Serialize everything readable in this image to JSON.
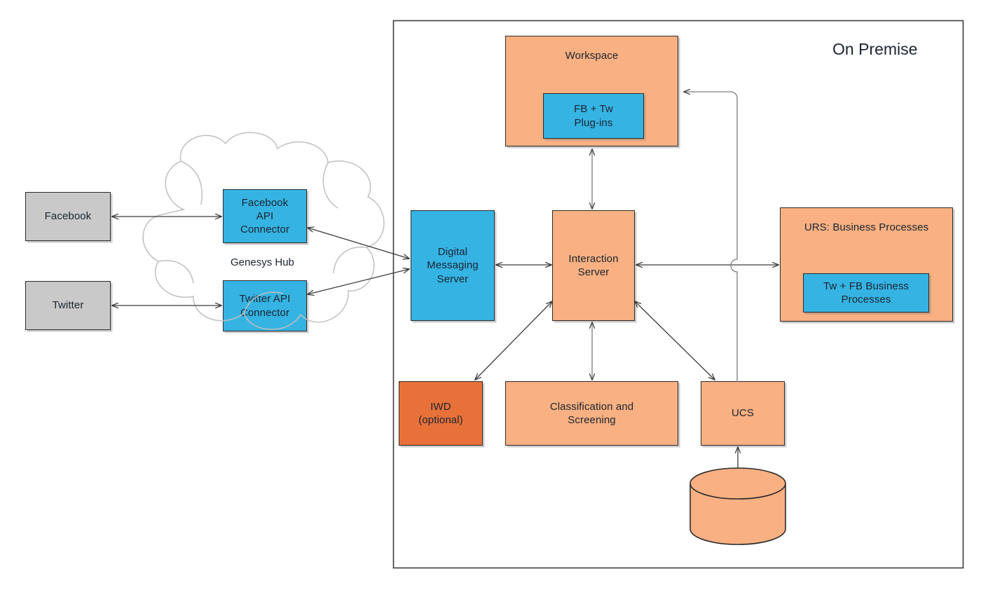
{
  "diagram": {
    "title_text": "On Premise",
    "cloud_label": "Genesys Hub",
    "colors": {
      "blue": "#35b3e3",
      "peach": "#f9b082",
      "orange": "#e8713a",
      "gray": "#c9c9c9",
      "stroke": "#2b2b2b",
      "cloud_stroke": "#bdbdbd",
      "text": "#1b2430"
    },
    "nodes": {
      "facebook": "Facebook",
      "twitter": "Twitter",
      "facebook_api_connector": "Facebook\nAPI\nConnector",
      "twitter_api_connector": "Twitter API\nConnector",
      "digital_messaging_server": "Digital\nMessaging\nServer",
      "interaction_server": "Interaction\nServer",
      "workspace": "Workspace",
      "fb_tw_plugins": "FB + Tw\nPlug-ins",
      "urs_business_processes": "URS: Business Processes",
      "tw_fb_business_processes": "Tw + FB Business\nProcesses",
      "iwd": "IWD\n(optional)",
      "classification_and_screening": "Classification and\nScreening",
      "ucs": "UCS",
      "ucs_database": "UCS Database"
    },
    "edges": [
      {
        "from": "Facebook",
        "to": "Facebook API Connector",
        "direction": "both"
      },
      {
        "from": "Twitter",
        "to": "Twitter API Connector",
        "direction": "both"
      },
      {
        "from": "Facebook API Connector",
        "to": "Digital Messaging Server",
        "direction": "both"
      },
      {
        "from": "Twitter API Connector",
        "to": "Digital Messaging Server",
        "direction": "both"
      },
      {
        "from": "Digital Messaging Server",
        "to": "Interaction Server",
        "direction": "both"
      },
      {
        "from": "Interaction Server",
        "to": "Workspace",
        "direction": "both"
      },
      {
        "from": "Interaction Server",
        "to": "URS: Business Processes",
        "direction": "both"
      },
      {
        "from": "Interaction Server",
        "to": "IWD (optional)",
        "direction": "both"
      },
      {
        "from": "Interaction Server",
        "to": "Classification and Screening",
        "direction": "both"
      },
      {
        "from": "Interaction Server",
        "to": "UCS",
        "direction": "both"
      },
      {
        "from": "UCS",
        "to": "Workspace",
        "direction": "to"
      },
      {
        "from": "UCS",
        "to": "UCS Database",
        "direction": "both"
      }
    ]
  }
}
